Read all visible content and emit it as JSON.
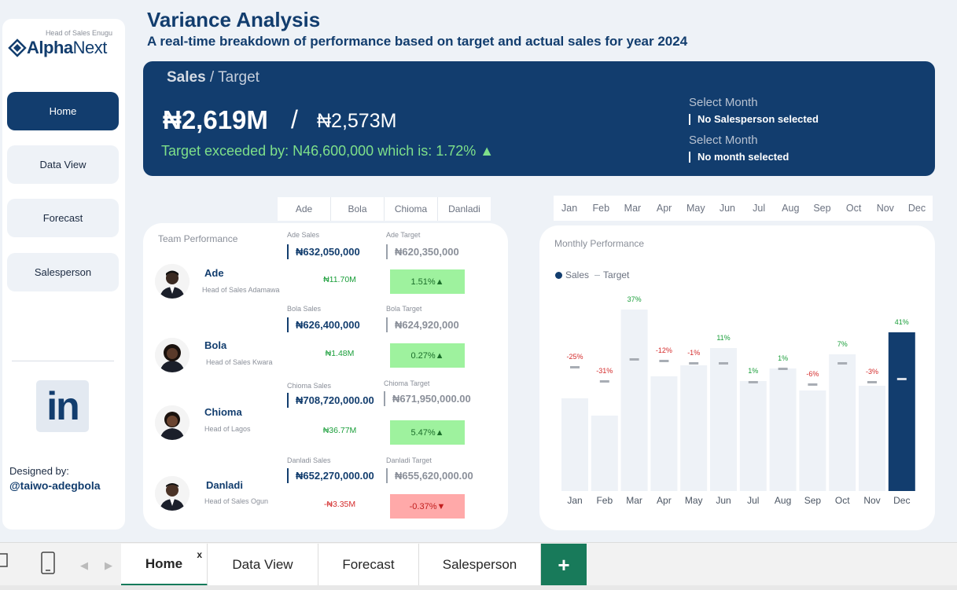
{
  "brand": {
    "subtitle": "Head of Sales Enugu",
    "name_bold": "Alpha",
    "name_rest": "Next"
  },
  "nav": {
    "items": [
      "Home",
      "Data View",
      "Forecast",
      "Salesperson"
    ],
    "active": "Home"
  },
  "linkedin": {
    "label": "in"
  },
  "designer": {
    "label": "Designed by:",
    "handle": "@taiwo-adegbola"
  },
  "header": {
    "title": "Variance Analysis",
    "subtitle": "A real-time breakdown of performance based on target and actual sales for year 2024"
  },
  "kpi": {
    "heading_bold": "Sales",
    "heading_rest": " / Target",
    "sales": "₦2,619M",
    "slash": "/",
    "target": "₦2,573M",
    "variance": "Target exceeded by: N46,600,000 which is: 1.72% ▲",
    "select1_label": "Select Month",
    "select1_value": "No Salesperson selected",
    "select2_label": "Select Month",
    "select2_value": "No month selected"
  },
  "person_tabs": [
    "Ade",
    "Bola",
    "Chioma",
    "Danladi"
  ],
  "month_tabs": [
    "Jan",
    "Feb",
    "Mar",
    "Apr",
    "May",
    "Jun",
    "Jul",
    "Aug",
    "Sep",
    "Oct",
    "Nov",
    "Dec"
  ],
  "team": {
    "title": "Team Performance",
    "people": [
      {
        "name": "Ade",
        "role": "Head of Sales Adamawa",
        "sales_label": "Ade Sales",
        "sales": "₦632,050,000",
        "target_label": "Ade Target",
        "target": "₦620,350,000",
        "diff": "₦11.70M",
        "pct": "1.51%▲",
        "positive": true
      },
      {
        "name": "Bola",
        "role": "Head of Sales Kwara",
        "sales_label": "Bola Sales",
        "sales": "₦626,400,000",
        "target_label": "Bola Target",
        "target": "₦624,920,000",
        "diff": "₦1.48M",
        "pct": "0.27%▲",
        "positive": true
      },
      {
        "name": "Chioma",
        "role": "Head of Lagos",
        "sales_label": "Chioma Sales",
        "sales": "₦708,720,000.00",
        "target_label": "Chioma Target",
        "target": "₦671,950,000.00",
        "diff": "₦36.77M",
        "pct": "5.47%▲",
        "positive": true
      },
      {
        "name": "Danladi",
        "role": "Head of Sales Ogun",
        "sales_label": "Danladi Sales",
        "sales": "₦652,270,000.00",
        "target_label": "Danladi Target",
        "target": "₦655,620,000.00",
        "diff": "-₦3.35M",
        "pct": "-0.37%▼",
        "positive": false
      }
    ]
  },
  "monthly": {
    "title": "Monthly Performance",
    "legend_sales": "Sales",
    "legend_target": "Target"
  },
  "chart_data": {
    "type": "bar",
    "title": "Monthly Performance",
    "categories": [
      "Jan",
      "Feb",
      "Mar",
      "Apr",
      "May",
      "Jun",
      "Jul",
      "Aug",
      "Sep",
      "Oct",
      "Nov",
      "Dec"
    ],
    "series": [
      {
        "name": "Sales",
        "values": [
          118,
          96,
          231,
          146,
          160,
          182,
          140,
          156,
          128,
          174,
          134,
          202
        ]
      },
      {
        "name": "Target",
        "values": [
          158,
          140,
          168,
          166,
          163,
          163,
          139,
          156,
          136,
          163,
          139,
          143
        ]
      }
    ],
    "labels": [
      "-25%",
      "-31%",
      "37%",
      "-12%",
      "-1%",
      "11%",
      "1%",
      "1%",
      "-6%",
      "7%",
      "-3%",
      "41%"
    ],
    "highlight": "Dec",
    "colors": {
      "bar": "#eef2f7",
      "highlight": "#123d6e",
      "target": "#a8adb4",
      "pos": "#1a9e3a",
      "neg": "#d42b2b"
    }
  },
  "sheets": {
    "tabs": [
      "Home",
      "Data View",
      "Forecast",
      "Salesperson"
    ],
    "active": "Home",
    "close": "x",
    "add": "+"
  }
}
